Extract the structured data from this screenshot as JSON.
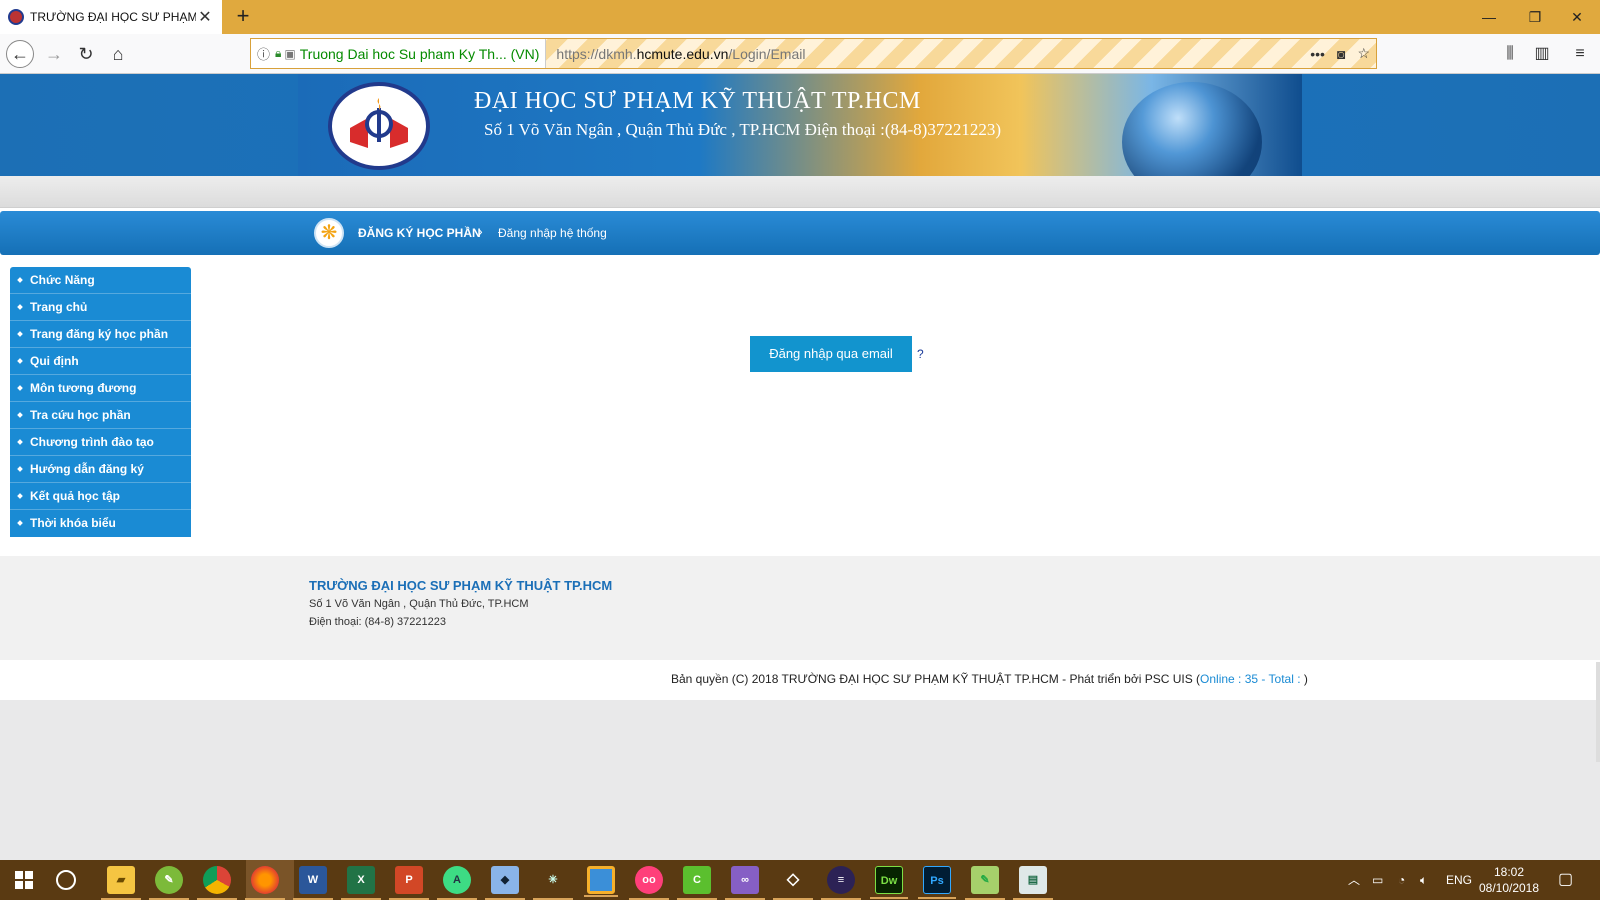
{
  "browser": {
    "tab_title": "TRƯỜNG ĐẠI HỌC SƯ PHẠM KỸ THUẬT TP.HCM",
    "url_org": "Truong Dai hoc Su pham Ky Th... (VN)",
    "url_prefix": "https://dkmh.",
    "url_domain": "hcmute.edu.vn",
    "url_path": "/Login/Email"
  },
  "banner": {
    "title": "ĐẠI HỌC SƯ PHẠM KỸ THUẬT TP.HCM",
    "subtitle": "Số 1 Võ Văn Ngân , Quận Thủ Đức , TP.HCM  Điện thoại :(84-8)37221223)"
  },
  "breadcrumb": {
    "root": "ĐĂNG KÝ HỌC PHẦN",
    "current": "Đăng nhập hệ thống"
  },
  "sidebar": {
    "items": [
      "Chức Năng",
      "Trang chủ",
      "Trang đăng ký học phần",
      "Qui định",
      "Môn tương đương",
      "Tra cứu học phần",
      "Chương trình đào tạo",
      "Hướng dẫn đăng ký",
      "Kết quả học tập",
      "Thời khóa biểu"
    ]
  },
  "main": {
    "login_button": "Đăng nhập qua email",
    "help_link": "?"
  },
  "footer": {
    "title": "TRƯỜNG ĐẠI HỌC SƯ PHẠM KỸ THUẬT TP.HCM",
    "address": "Số 1 Võ Văn Ngân , Quận Thủ Đức, TP.HCM",
    "phone": "Điện thoại: (84-8) 37221223",
    "copyright": "Bản quyền (C) 2018 TRƯỜNG ĐẠI HỌC SƯ PHẠM KỸ THUẬT TP.HCM - Phát triển bởi PSC UIS (",
    "online": "Online : 35 - Total : ",
    "copyright_end": ")"
  },
  "taskbar": {
    "language": "ENG",
    "time": "18:02",
    "date": "08/10/2018",
    "apps": [
      "file-explorer-icon",
      "greenshot-icon",
      "chrome-icon",
      "firefox-icon",
      "word-icon",
      "excel-icon",
      "powerpoint-icon",
      "android-studio-icon",
      "virtualbox-icon",
      "network-tool-icon",
      "sublime-icon",
      "flickr-icon",
      "camtasia-icon",
      "visual-studio-icon",
      "unity-icon",
      "eclipse-icon",
      "dreamweaver-icon",
      "photoshop-icon",
      "notepadpp-icon",
      "presentation-icon"
    ]
  },
  "colors": {
    "taskbar": "#5a3a12",
    "tabbar": "#e0a93e",
    "sidebar": "#1a8bd4",
    "crumbbar": "#1570b6",
    "login_button": "#1294ce"
  }
}
